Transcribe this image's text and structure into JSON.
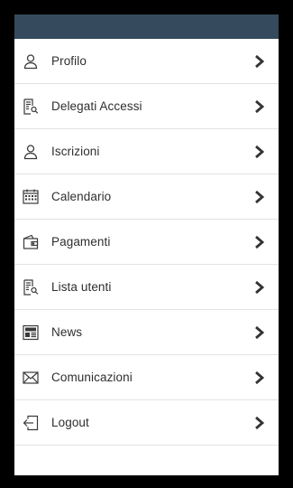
{
  "header": {
    "bar_color": "#354a5c"
  },
  "menu": {
    "items": [
      {
        "label": "Profilo",
        "icon": "user-icon"
      },
      {
        "label": "Delegati Accessi",
        "icon": "document-search-icon"
      },
      {
        "label": "Iscrizioni",
        "icon": "user-icon"
      },
      {
        "label": "Calendario",
        "icon": "calendar-icon"
      },
      {
        "label": "Pagamenti",
        "icon": "wallet-icon"
      },
      {
        "label": "Lista utenti",
        "icon": "document-search-icon"
      },
      {
        "label": "News",
        "icon": "newspaper-icon"
      },
      {
        "label": "Comunicazioni",
        "icon": "envelope-icon"
      },
      {
        "label": "Logout",
        "icon": "logout-icon"
      }
    ]
  },
  "colors": {
    "icon": "#3a3a3a",
    "text": "#2e2e2e",
    "divider": "#e2e2e2",
    "chevron": "#333333"
  }
}
